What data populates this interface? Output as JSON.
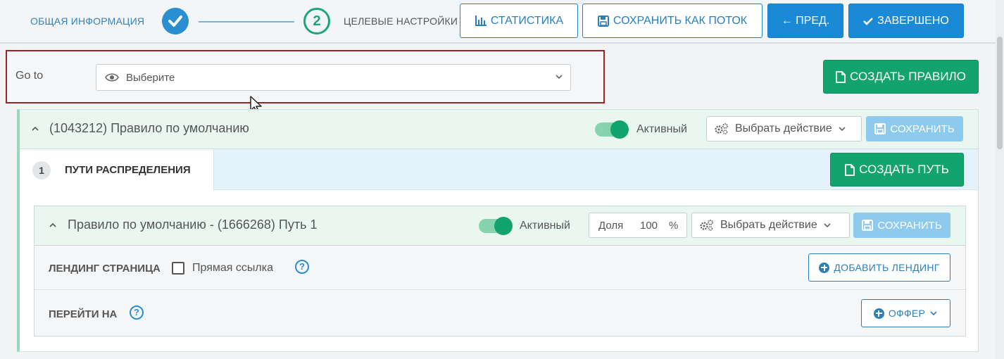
{
  "wizard": {
    "step1_label": "ОБЩАЯ ИНФОРМАЦИЯ",
    "step2_number": "2",
    "step2_label": "ЦЕЛЕВЫЕ НАСТРОЙКИ",
    "statistics_label": "СТАТИСТИКА",
    "save_as_flow_label": "СОХРАНИТЬ КАК ПОТОК",
    "prev_label": "← ПРЕД.",
    "done_label": "ЗАВЕРШЕНО"
  },
  "goto": {
    "label": "Go to",
    "select_value": "Выберите"
  },
  "create_rule_label": "СОЗДАТЬ ПРАВИЛО",
  "rule": {
    "title": "(1043212) Правило по умолчанию",
    "active_label": "Активный",
    "action_label": "Выбрать действие",
    "save_label": "СОХРАНИТЬ",
    "tab_number": "1",
    "tab_label": "ПУТИ РАСПРЕДЕЛЕНИЯ",
    "create_path_label": "СОЗДАТЬ ПУТЬ"
  },
  "path": {
    "title": "Правило по умолчанию - (1666268) Путь 1",
    "active_label": "Активный",
    "share_label": "Доля",
    "share_value": "100",
    "share_unit": "%",
    "action_label": "Выбрать действие",
    "save_label": "СОХРАНИТЬ",
    "landing_label": "ЛЕНДИНГ СТРАНИЦА",
    "direct_link_label": "Прямая ссылка",
    "help_symbol": "?",
    "add_landing_label": "ДОБАВИТЬ ЛЕНДИНГ",
    "goto_label": "ПЕРЕЙТИ НА",
    "offer_label": "ОФФЕР"
  },
  "colors": {
    "accent_blue": "#1b8ad6",
    "accent_green": "#13a36e",
    "highlight_frame": "#9b2525"
  }
}
